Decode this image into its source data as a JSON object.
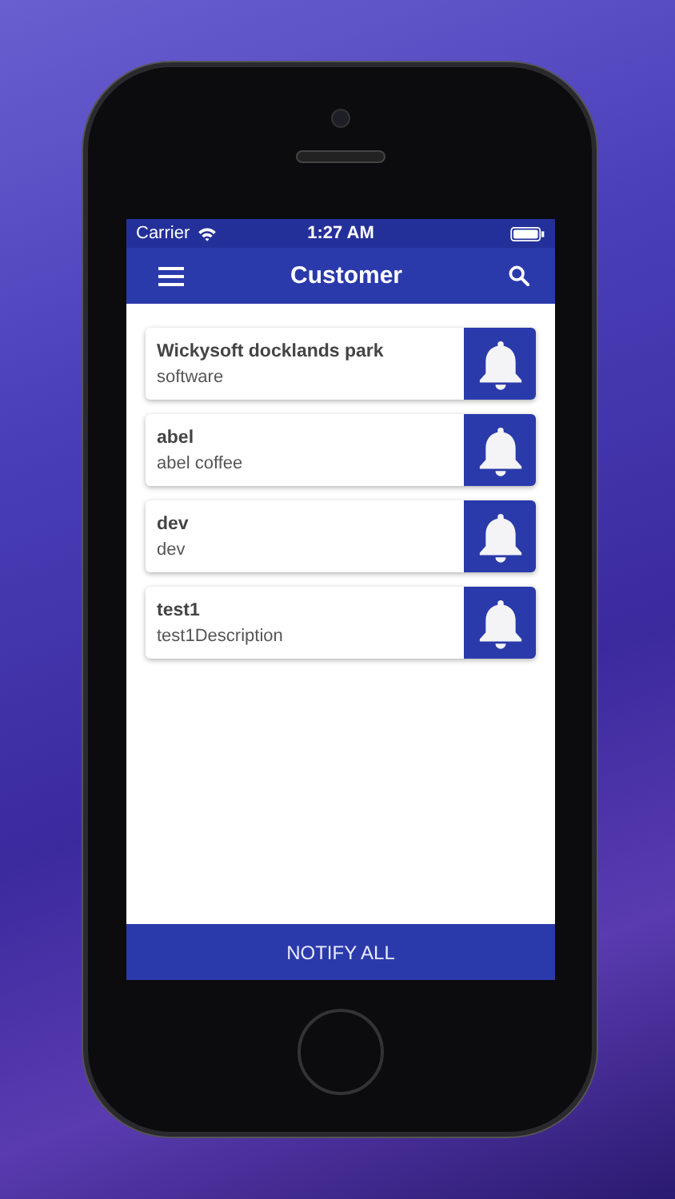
{
  "status_bar": {
    "carrier": "Carrier",
    "time": "1:27 AM"
  },
  "app_bar": {
    "title": "Customer"
  },
  "customers": [
    {
      "name": "Wickysoft docklands park",
      "description": "software"
    },
    {
      "name": "abel",
      "description": "abel coffee"
    },
    {
      "name": "dev",
      "description": "dev"
    },
    {
      "name": "test1",
      "description": "test1Description"
    }
  ],
  "footer_button": {
    "label": "NOTIFY ALL"
  }
}
